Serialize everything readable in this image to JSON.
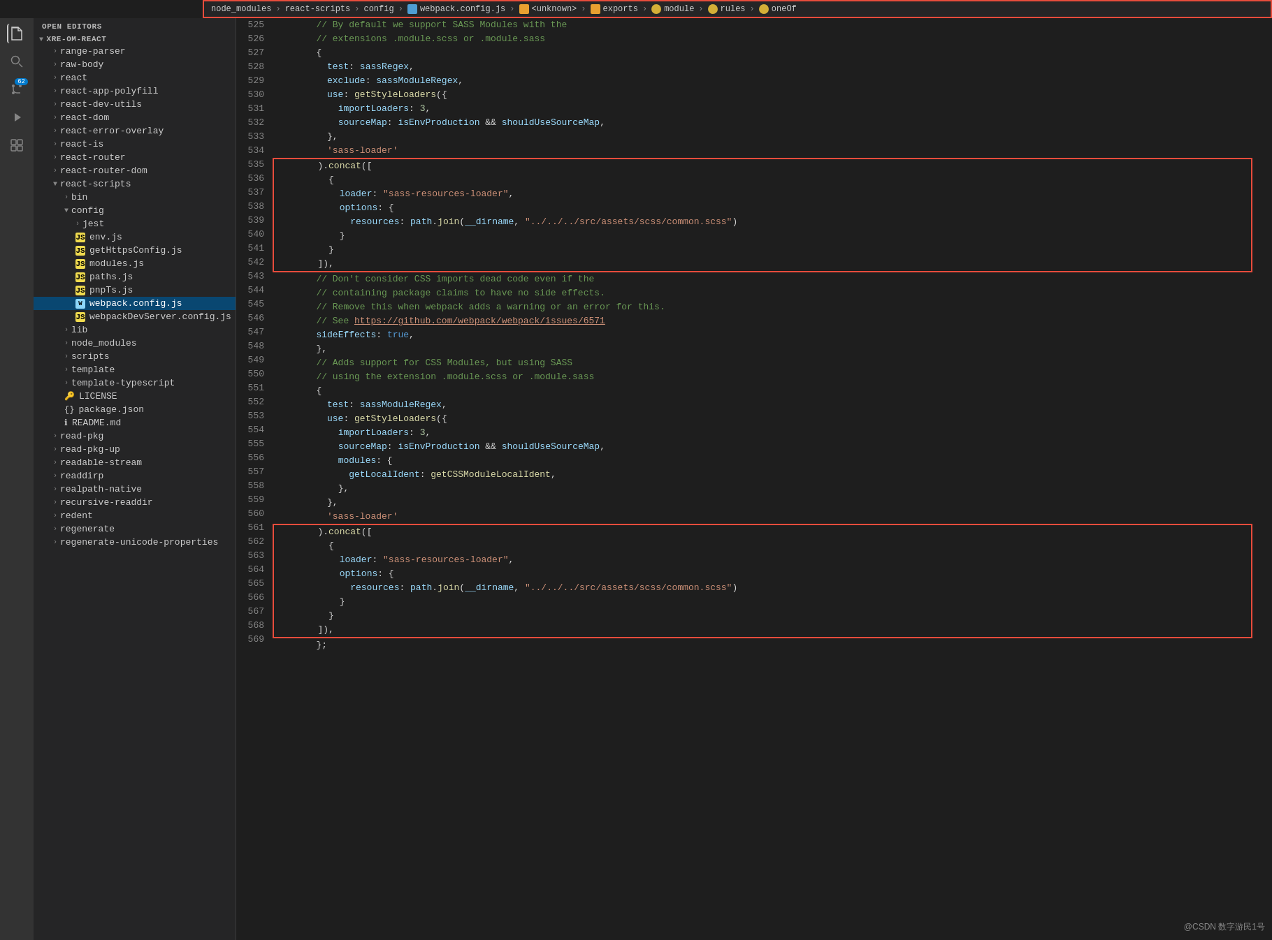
{
  "breadcrumb": {
    "items": [
      {
        "label": "node_modules",
        "type": "folder"
      },
      {
        "label": "react-scripts",
        "type": "folder"
      },
      {
        "label": "config",
        "type": "folder"
      },
      {
        "label": "webpack.config.js",
        "type": "webpack"
      },
      {
        "label": "<unknown>",
        "type": "unknown"
      },
      {
        "label": "exports",
        "type": "unknown"
      },
      {
        "label": "module",
        "type": "key"
      },
      {
        "label": "rules",
        "type": "key"
      },
      {
        "label": "oneOf",
        "type": "key"
      }
    ]
  },
  "sidebar": {
    "header": "OPEN EDITORS",
    "project": "XRE-OM-REACT",
    "items": [
      {
        "label": "range-parser",
        "indent": 1,
        "type": "folder",
        "expanded": false
      },
      {
        "label": "raw-body",
        "indent": 1,
        "type": "folder",
        "expanded": false
      },
      {
        "label": "react",
        "indent": 1,
        "type": "folder",
        "expanded": false
      },
      {
        "label": "react-app-polyfill",
        "indent": 1,
        "type": "folder",
        "expanded": false
      },
      {
        "label": "react-dev-utils",
        "indent": 1,
        "type": "folder",
        "expanded": false
      },
      {
        "label": "react-dom",
        "indent": 1,
        "type": "folder",
        "expanded": false
      },
      {
        "label": "react-error-overlay",
        "indent": 1,
        "type": "folder",
        "expanded": false
      },
      {
        "label": "react-is",
        "indent": 1,
        "type": "folder",
        "expanded": false
      },
      {
        "label": "react-router",
        "indent": 1,
        "type": "folder",
        "expanded": false
      },
      {
        "label": "react-router-dom",
        "indent": 1,
        "type": "folder",
        "expanded": false
      },
      {
        "label": "react-scripts",
        "indent": 1,
        "type": "folder",
        "expanded": true
      },
      {
        "label": "bin",
        "indent": 2,
        "type": "folder",
        "expanded": false
      },
      {
        "label": "config",
        "indent": 2,
        "type": "folder",
        "expanded": true
      },
      {
        "label": "jest",
        "indent": 3,
        "type": "folder",
        "expanded": false
      },
      {
        "label": "env.js",
        "indent": 3,
        "type": "js"
      },
      {
        "label": "getHttpsConfig.js",
        "indent": 3,
        "type": "js"
      },
      {
        "label": "modules.js",
        "indent": 3,
        "type": "js"
      },
      {
        "label": "paths.js",
        "indent": 3,
        "type": "js"
      },
      {
        "label": "pnpTs.js",
        "indent": 3,
        "type": "js"
      },
      {
        "label": "webpack.config.js",
        "indent": 3,
        "type": "webpack",
        "active": true
      },
      {
        "label": "webpackDevServer.config.js",
        "indent": 3,
        "type": "js"
      },
      {
        "label": "lib",
        "indent": 2,
        "type": "folder",
        "expanded": false
      },
      {
        "label": "node_modules",
        "indent": 2,
        "type": "folder",
        "expanded": false
      },
      {
        "label": "scripts",
        "indent": 2,
        "type": "folder",
        "expanded": false
      },
      {
        "label": "template",
        "indent": 2,
        "type": "folder",
        "expanded": false
      },
      {
        "label": "template-typescript",
        "indent": 2,
        "type": "folder",
        "expanded": false
      },
      {
        "label": "LICENSE",
        "indent": 2,
        "type": "license"
      },
      {
        "label": "package.json",
        "indent": 2,
        "type": "json"
      },
      {
        "label": "README.md",
        "indent": 2,
        "type": "md"
      },
      {
        "label": "read-pkg",
        "indent": 1,
        "type": "folder",
        "expanded": false
      },
      {
        "label": "read-pkg-up",
        "indent": 1,
        "type": "folder",
        "expanded": false
      },
      {
        "label": "readable-stream",
        "indent": 1,
        "type": "folder",
        "expanded": false
      },
      {
        "label": "readdirp",
        "indent": 1,
        "type": "folder",
        "expanded": false
      },
      {
        "label": "realpath-native",
        "indent": 1,
        "type": "folder",
        "expanded": false
      },
      {
        "label": "recursive-readdir",
        "indent": 1,
        "type": "folder",
        "expanded": false
      },
      {
        "label": "redent",
        "indent": 1,
        "type": "folder",
        "expanded": false
      },
      {
        "label": "regenerate",
        "indent": 1,
        "type": "folder",
        "expanded": false
      },
      {
        "label": "regenerate-unicode-properties",
        "indent": 1,
        "type": "folder",
        "expanded": false
      }
    ]
  },
  "code": {
    "lines": [
      {
        "num": 525,
        "text": "        // By default we support SASS Modules with the",
        "type": "comment"
      },
      {
        "num": 526,
        "text": "        // extensions .module.scss or .module.sass",
        "type": "comment"
      },
      {
        "num": 527,
        "text": "        {",
        "type": "code"
      },
      {
        "num": 528,
        "text": "          test: sassRegex,",
        "type": "code"
      },
      {
        "num": 529,
        "text": "          exclude: sassModuleRegex,",
        "type": "code"
      },
      {
        "num": 530,
        "text": "          use: getStyleLoaders({",
        "type": "code"
      },
      {
        "num": 531,
        "text": "            importLoaders: 3,",
        "type": "code"
      },
      {
        "num": 532,
        "text": "            sourceMap: isEnvProduction && shouldUseSourceMap,",
        "type": "code"
      },
      {
        "num": 533,
        "text": "          },",
        "type": "code"
      },
      {
        "num": 534,
        "text": "          'sass-loader'",
        "type": "code"
      },
      {
        "num": 535,
        "text": "        ).concat([",
        "type": "highlight1_start"
      },
      {
        "num": 536,
        "text": "          {",
        "type": "highlight1"
      },
      {
        "num": 537,
        "text": "            loader: \"sass-resources-loader\",",
        "type": "highlight1"
      },
      {
        "num": 538,
        "text": "            options: {",
        "type": "highlight1"
      },
      {
        "num": 539,
        "text": "              resources: path.join(__dirname, \"../../../src/assets/scss/common.scss\")",
        "type": "highlight1"
      },
      {
        "num": 540,
        "text": "            }",
        "type": "highlight1"
      },
      {
        "num": 541,
        "text": "          }",
        "type": "highlight1"
      },
      {
        "num": 542,
        "text": "        ]),",
        "type": "highlight1_end"
      },
      {
        "num": 543,
        "text": "        // Don't consider CSS imports dead code even if the",
        "type": "comment"
      },
      {
        "num": 544,
        "text": "        // containing package claims to have no side effects.",
        "type": "comment"
      },
      {
        "num": 545,
        "text": "        // Remove this when webpack adds a warning or an error for this.",
        "type": "comment"
      },
      {
        "num": 546,
        "text": "        // See https://github.com/webpack/webpack/issues/6571",
        "type": "comment_url"
      },
      {
        "num": 547,
        "text": "        sideEffects: true,",
        "type": "code"
      },
      {
        "num": 548,
        "text": "        },",
        "type": "code"
      },
      {
        "num": 549,
        "text": "        // Adds support for CSS Modules, but using SASS",
        "type": "comment"
      },
      {
        "num": 550,
        "text": "        // using the extension .module.scss or .module.sass",
        "type": "comment"
      },
      {
        "num": 551,
        "text": "        {",
        "type": "code"
      },
      {
        "num": 552,
        "text": "          test: sassModuleRegex,",
        "type": "code"
      },
      {
        "num": 553,
        "text": "          use: getStyleLoaders({",
        "type": "code"
      },
      {
        "num": 554,
        "text": "            importLoaders: 3,",
        "type": "code"
      },
      {
        "num": 555,
        "text": "            sourceMap: isEnvProduction && shouldUseSourceMap,",
        "type": "code"
      },
      {
        "num": 556,
        "text": "            modules: {",
        "type": "code"
      },
      {
        "num": 557,
        "text": "              getLocalIdent: getCSSModuleLocalIdent,",
        "type": "code"
      },
      {
        "num": 558,
        "text": "            },",
        "type": "code"
      },
      {
        "num": 559,
        "text": "          },",
        "type": "code"
      },
      {
        "num": 560,
        "text": "          'sass-loader'",
        "type": "code"
      },
      {
        "num": 561,
        "text": "        ).concat([",
        "type": "highlight2_start"
      },
      {
        "num": 562,
        "text": "          {",
        "type": "highlight2"
      },
      {
        "num": 563,
        "text": "            loader: \"sass-resources-loader\",",
        "type": "highlight2"
      },
      {
        "num": 564,
        "text": "            options: {",
        "type": "highlight2"
      },
      {
        "num": 565,
        "text": "              resources: path.join(__dirname, \"../../../src/assets/scss/common.scss\")",
        "type": "highlight2"
      },
      {
        "num": 566,
        "text": "            }",
        "type": "highlight2"
      },
      {
        "num": 567,
        "text": "          }",
        "type": "highlight2"
      },
      {
        "num": 568,
        "text": "        ]),",
        "type": "highlight2_end"
      },
      {
        "num": 569,
        "text": "        };",
        "type": "code"
      }
    ]
  },
  "watermark": "@CSDN 数字游民1号",
  "activity": {
    "icons": [
      "files",
      "search",
      "source-control",
      "debug",
      "extensions"
    ]
  }
}
